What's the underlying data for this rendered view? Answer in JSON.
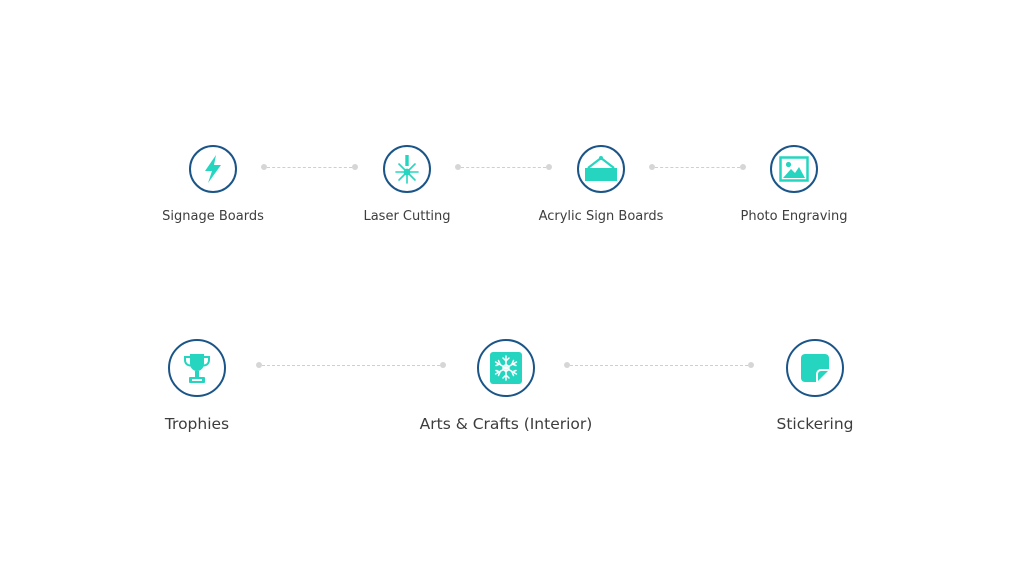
{
  "colors": {
    "accent": "#26d5bf",
    "ring": "#1b5588",
    "label": "#3d3d3d",
    "connector": "#d6d6d6"
  },
  "row1": {
    "items": [
      {
        "label": "Signage Boards",
        "icon": "lightning-icon"
      },
      {
        "label": "Laser Cutting",
        "icon": "laser-icon"
      },
      {
        "label": "Acrylic Sign Boards",
        "icon": "hanging-sign-icon"
      },
      {
        "label": "Photo Engraving",
        "icon": "picture-frame-icon"
      }
    ]
  },
  "row2": {
    "items": [
      {
        "label": "Trophies",
        "icon": "trophy-icon"
      },
      {
        "label": "Arts & Crafts (Interior)",
        "icon": "snowflake-icon"
      },
      {
        "label": "Stickering",
        "icon": "sticker-icon"
      }
    ]
  }
}
